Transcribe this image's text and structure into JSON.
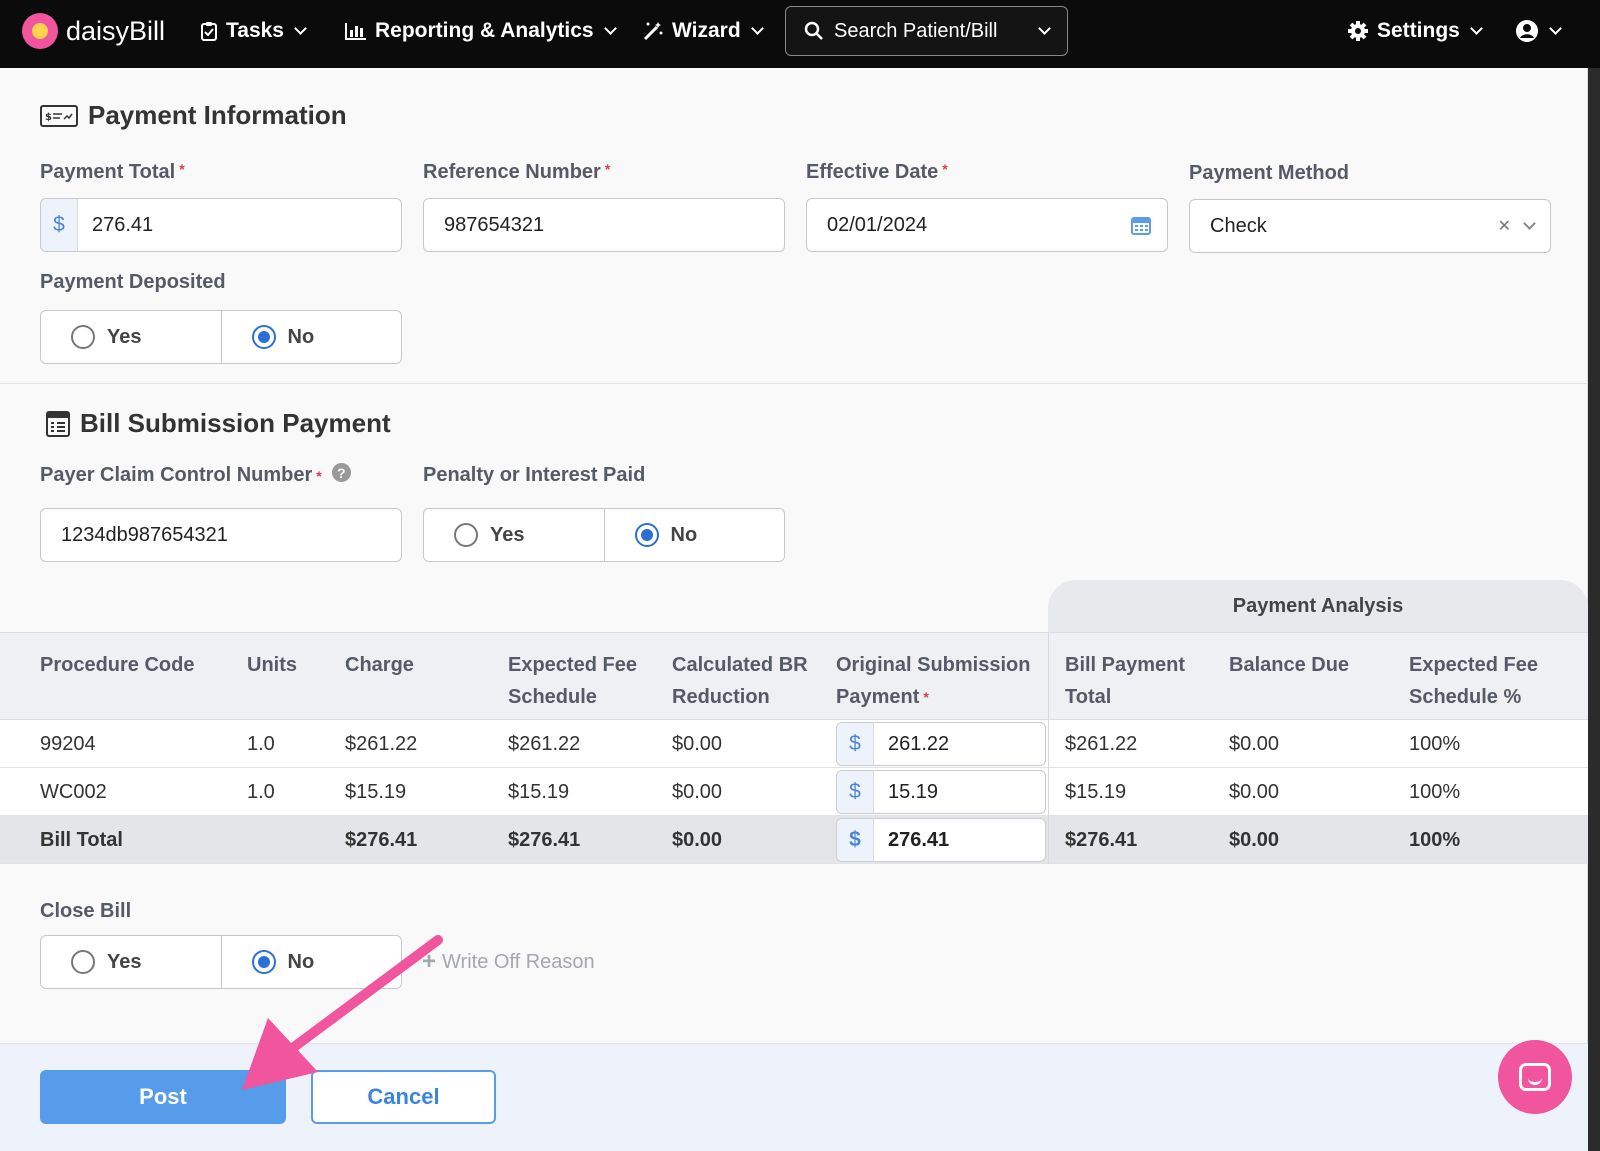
{
  "topbar": {
    "brand": "daisyBill",
    "nav": {
      "tasks": "Tasks",
      "reporting": "Reporting & Analytics",
      "wizard": "Wizard",
      "search": "Search Patient/Bill",
      "settings": "Settings"
    }
  },
  "payment_info": {
    "title": "Payment Information",
    "payment_total": {
      "label": "Payment Total",
      "prefix": "$",
      "value": "276.41"
    },
    "reference_number": {
      "label": "Reference Number",
      "value": "987654321"
    },
    "effective_date": {
      "label": "Effective Date",
      "value": "02/01/2024"
    },
    "payment_method": {
      "label": "Payment Method",
      "value": "Check"
    },
    "payment_deposited": {
      "label": "Payment Deposited",
      "yes": "Yes",
      "no": "No",
      "selected": "No"
    }
  },
  "bill_submission": {
    "title": "Bill Submission Payment",
    "payer_claim_control_number": {
      "label": "Payer Claim Control Number",
      "value": "1234db987654321"
    },
    "penalty_interest": {
      "label": "Penalty or Interest Paid",
      "yes": "Yes",
      "no": "No",
      "selected": "No"
    }
  },
  "table": {
    "payment_analysis_header": "Payment Analysis",
    "columns": {
      "procedure_code": "Procedure Code",
      "units": "Units",
      "charge": "Charge",
      "expected_fee_1": "Expected Fee",
      "expected_fee_2": "Schedule",
      "calc_br_1": "Calculated BR",
      "calc_br_2": "Reduction",
      "orig_sub_1": "Original Submission",
      "orig_sub_2": "Payment",
      "bill_payment_1": "Bill Payment",
      "bill_payment_2": "Total",
      "balance_due": "Balance Due",
      "expected_pct_1": "Expected Fee",
      "expected_pct_2": "Schedule %"
    },
    "rows": [
      {
        "code": "99204",
        "units": "1.0",
        "charge": "$261.22",
        "expected_fee": "$261.22",
        "br_reduction": "$0.00",
        "currency": "$",
        "original_payment": "261.22",
        "bill_payment_total": "$261.22",
        "balance_due": "$0.00",
        "expected_pct": "100%"
      },
      {
        "code": "WC002",
        "units": "1.0",
        "charge": "$15.19",
        "expected_fee": "$15.19",
        "br_reduction": "$0.00",
        "currency": "$",
        "original_payment": "15.19",
        "bill_payment_total": "$15.19",
        "balance_due": "$0.00",
        "expected_pct": "100%"
      }
    ],
    "total": {
      "label": "Bill Total",
      "charge": "$276.41",
      "expected_fee": "$276.41",
      "br_reduction": "$0.00",
      "currency": "$",
      "original_payment": "276.41",
      "bill_payment_total": "$276.41",
      "balance_due": "$0.00",
      "expected_pct": "100%"
    }
  },
  "close_bill": {
    "label": "Close Bill",
    "yes": "Yes",
    "no": "No",
    "selected": "No",
    "write_off": "Write Off Reason"
  },
  "footer": {
    "post": "Post",
    "cancel": "Cancel"
  },
  "colors": {
    "accent": "#579cea",
    "annotation_arrow": "#f0559d",
    "required": "#e0394a"
  }
}
